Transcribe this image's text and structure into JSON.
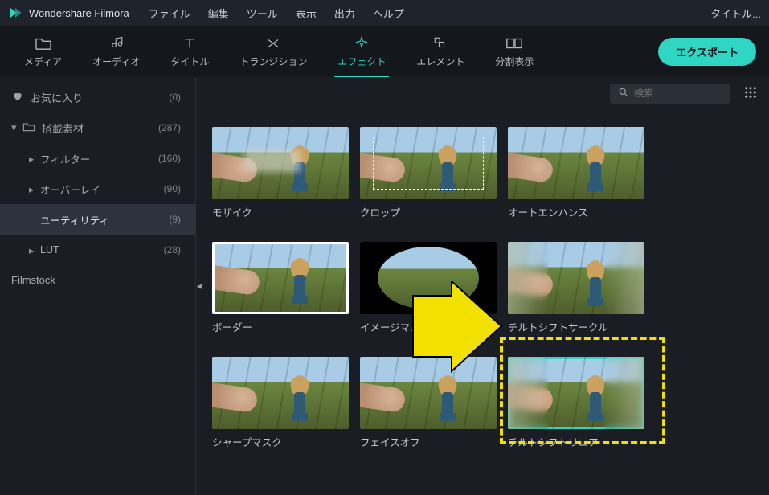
{
  "titlebar": {
    "app_name": "Wondershare Filmora",
    "menu": [
      "ファイル",
      "編集",
      "ツール",
      "表示",
      "出力",
      "ヘルプ"
    ],
    "right_text": "タイトル..."
  },
  "tabs": [
    {
      "name": "media",
      "label": "メディア"
    },
    {
      "name": "audio",
      "label": "オーディオ"
    },
    {
      "name": "title",
      "label": "タイトル"
    },
    {
      "name": "transition",
      "label": "トランジション"
    },
    {
      "name": "effect",
      "label": "エフェクト",
      "active": true
    },
    {
      "name": "element",
      "label": "エレメント"
    },
    {
      "name": "split",
      "label": "分割表示"
    }
  ],
  "export_label": "エクスポート",
  "sidebar": {
    "favorites": {
      "label": "お気に入り",
      "count": "(0)"
    },
    "builtin": {
      "label": "搭載素材",
      "count": "(287)"
    },
    "children": [
      {
        "key": "filter",
        "label": "フィルター",
        "count": "(160)"
      },
      {
        "key": "overlay",
        "label": "オーバーレイ",
        "count": "(90)"
      },
      {
        "key": "utility",
        "label": "ユーティリティ",
        "count": "(9)",
        "selected": true
      },
      {
        "key": "lut",
        "label": "LUT",
        "count": "(28)"
      }
    ],
    "filmstock": "Filmstock"
  },
  "search": {
    "placeholder": "検索"
  },
  "effects": [
    {
      "key": "mosaic",
      "label": "モザイク",
      "variant": "mosaic"
    },
    {
      "key": "crop",
      "label": "クロップ",
      "variant": "crop"
    },
    {
      "key": "autoenhance",
      "label": "オートエンハンス",
      "variant": "plain"
    },
    {
      "key": "border",
      "label": "ボーダー",
      "variant": "border"
    },
    {
      "key": "imagemask",
      "label": "イメージマ...",
      "variant": "oval"
    },
    {
      "key": "tiltcircle",
      "label": "チルトシフトサークル",
      "variant": "blur"
    },
    {
      "key": "sharpmask",
      "label": "シャープマスク",
      "variant": "plain"
    },
    {
      "key": "faceoff",
      "label": "フェイスオフ",
      "variant": "plain"
    },
    {
      "key": "tiltlinear",
      "label": "チルトシフトリニア",
      "variant": "blur",
      "selected": true
    }
  ],
  "annotation": {
    "highlight_target": "tiltlinear"
  }
}
